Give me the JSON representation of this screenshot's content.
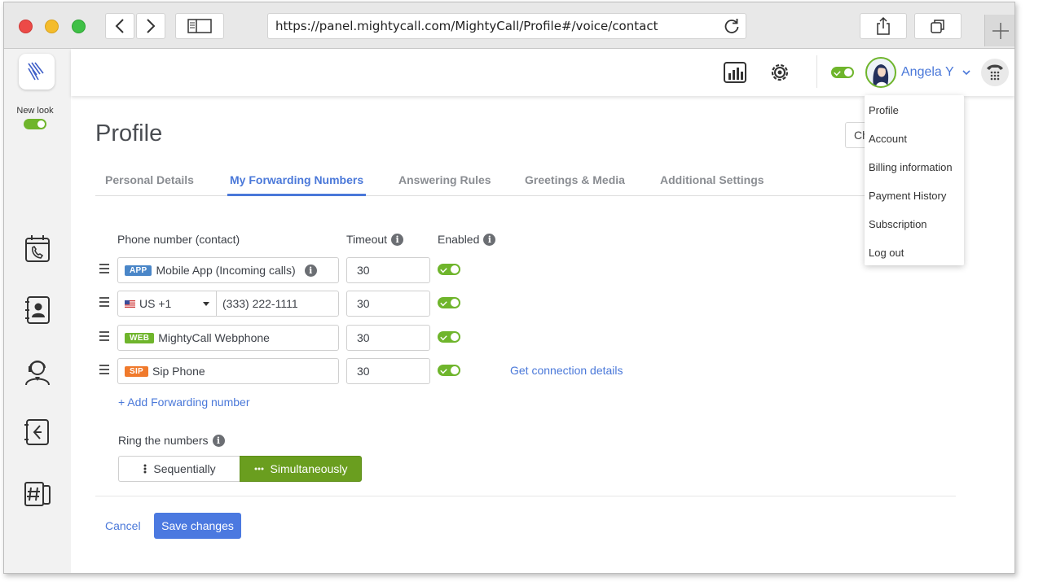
{
  "browser": {
    "url": "https://panel.mightycall.com/MightyCall/Profile#/voice/contact"
  },
  "sidebar": {
    "new_look_label": "New look",
    "icons": [
      "calendar-phone-icon",
      "contacts-icon",
      "agent-icon",
      "call-routing-icon",
      "keypad-hash-icon"
    ]
  },
  "topbar": {
    "user_name": "Angela Y"
  },
  "page": {
    "title": "Profile",
    "hidden_button_label": "Ch"
  },
  "tabs": [
    {
      "label": "Personal Details",
      "active": false
    },
    {
      "label": "My Forwarding Numbers",
      "active": true
    },
    {
      "label": "Answering Rules",
      "active": false
    },
    {
      "label": "Greetings & Media",
      "active": false
    },
    {
      "label": "Additional Settings",
      "active": false
    }
  ],
  "columns": {
    "phone": "Phone number (contact)",
    "timeout": "Timeout",
    "enabled": "Enabled"
  },
  "rows": [
    {
      "badge": "APP",
      "badge_color": "#4a86c8",
      "label": "Mobile App (Incoming calls)",
      "timeout": "30",
      "enabled": true
    },
    {
      "country": "US +1",
      "phone": "(333) 222-1111",
      "timeout": "30",
      "enabled": true
    },
    {
      "badge": "WEB",
      "badge_color": "#6fb52c",
      "label": "MightyCall Webphone",
      "timeout": "30",
      "enabled": true
    },
    {
      "badge": "SIP",
      "badge_color": "#f07a2c",
      "label": "Sip Phone",
      "timeout": "30",
      "enabled": true,
      "link": "Get connection details"
    }
  ],
  "add_number_label": "+ Add Forwarding number",
  "ring": {
    "label": "Ring the numbers",
    "options": [
      "Sequentially",
      "Simultaneously"
    ],
    "selected": "Simultaneously"
  },
  "actions": {
    "cancel": "Cancel",
    "save": "Save changes"
  },
  "user_menu": [
    "Profile",
    "Account",
    "Billing information",
    "Payment History",
    "Subscription",
    "Log out"
  ],
  "colors": {
    "accent": "#4a78d9",
    "green": "#6fb52c",
    "segment_selected": "#6a9e1f"
  }
}
